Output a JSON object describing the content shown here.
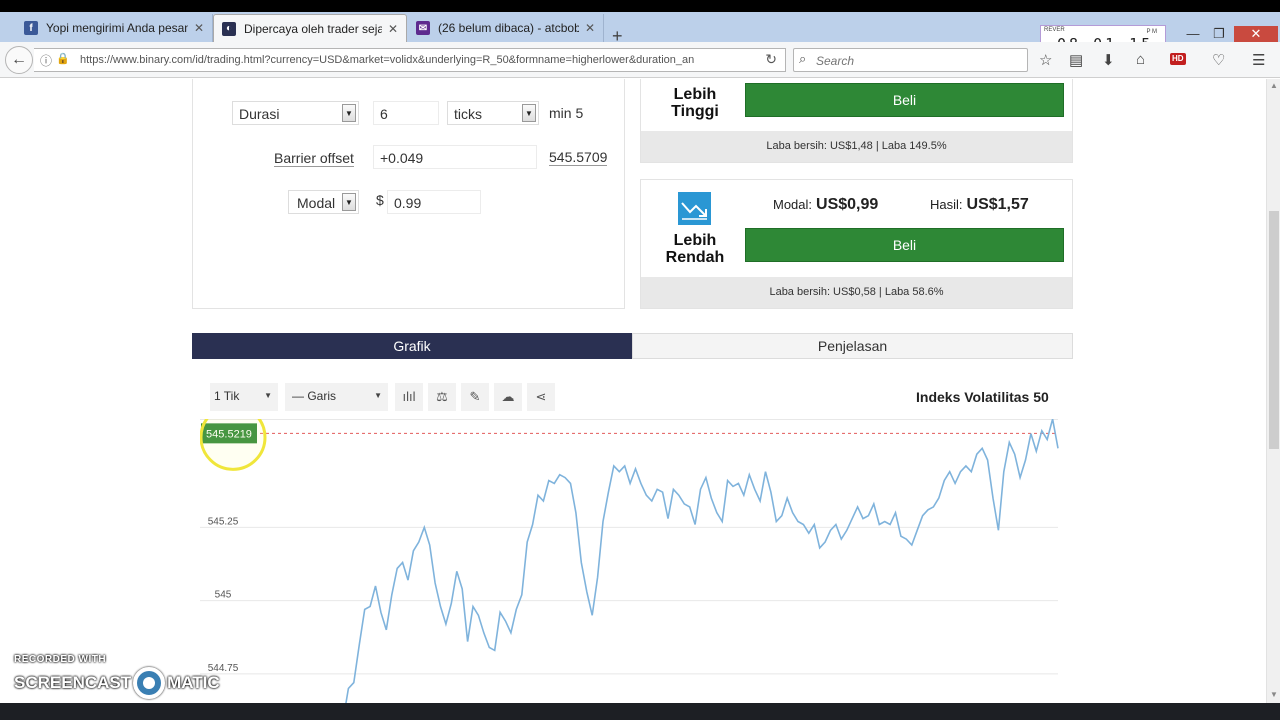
{
  "browser": {
    "tabs": [
      {
        "label": "Yopi mengirimi Anda pesan",
        "close": "✕",
        "favicon": "f"
      },
      {
        "label": "Dipercaya oleh trader sejak...",
        "close": "✕",
        "favicon": "◐"
      },
      {
        "label": "(26 belum dibaca) - atcbob...",
        "close": "✕",
        "favicon": "✉"
      }
    ],
    "new_tab": "+",
    "clock": {
      "brand": "REVER",
      "time": "08 01 15",
      "ampm": "P M"
    },
    "window": {
      "minimize": "—",
      "restore": "❐",
      "close": "✕"
    },
    "url": "https://www.binary.com/id/trading.html?currency=USD&market=volidx&underlying=R_50&formname=higherlower&duration_an",
    "search_placeholder": "Search",
    "hd_badge": "HD",
    "colors": {
      "tab_strip": "#bcd0ea",
      "nav": "#f5f6f7"
    }
  },
  "form": {
    "duration_label": "Durasi",
    "duration_value": "6",
    "duration_unit": "ticks",
    "duration_min": "min 5",
    "barrier_label": "Barrier offset",
    "barrier_value": "+0.049",
    "barrier_price": "545.5709",
    "amount_label": "Modal",
    "currency_symbol": "$",
    "amount_value": "0.99"
  },
  "contracts": {
    "higher": {
      "title_line1": "Lebih",
      "title_line2": "Tinggi",
      "buy_label": "Beli",
      "footer": "Laba bersih: US$1,48 | Laba 149.5%"
    },
    "lower": {
      "title_line1": "Lebih",
      "title_line2": "Rendah",
      "stake_label": "Modal:",
      "stake_value": "US$0,99",
      "payout_label": "Hasil:",
      "payout_value": "US$1,57",
      "buy_label": "Beli",
      "footer": "Laba bersih: US$0,58 | Laba 58.6%",
      "icon_color": "#2a97d4"
    },
    "buy_color": "#2e8836"
  },
  "chart_tabs": {
    "active": "Grafik",
    "inactive": "Penjelasan",
    "active_color": "#2a3052"
  },
  "chart_toolbar": {
    "timeframe": "1 Tik",
    "chart_type": "— Garis",
    "icons": [
      "indicators-icon",
      "compare-icon",
      "draw-icon",
      "download-icon",
      "share-icon"
    ],
    "title": "Indeks Volatilitas 50"
  },
  "chart_data": {
    "type": "line",
    "title": "Indeks Volatilitas 50",
    "y_ticks": [
      "545.25",
      "545",
      "544.75"
    ],
    "ylim": [
      544.63,
      545.62
    ],
    "current_price_label": "545.5219",
    "barrier_level": 545.571,
    "line_color": "#7fb3dc",
    "barrier_color": "#e25b5b",
    "price_tag_color": "#2e8836",
    "series": [
      {
        "values": [
          544.59,
          544.7,
          544.72,
          544.85,
          544.97,
          544.98,
          545.05,
          544.96,
          544.9,
          545.02,
          545.11,
          545.13,
          545.07,
          545.17,
          545.2,
          545.25,
          545.19,
          545.06,
          544.98,
          544.92,
          544.99,
          545.1,
          545.04,
          544.86,
          544.98,
          544.95,
          544.89,
          544.84,
          544.83,
          544.96,
          544.93,
          544.89,
          544.97,
          545.02,
          545.2,
          545.26,
          545.36,
          545.34,
          545.41,
          545.4,
          545.43,
          545.42,
          545.4,
          545.3,
          545.13,
          545.03,
          544.95,
          545.08,
          545.27,
          545.37,
          545.46,
          545.44,
          545.46,
          545.4,
          545.45,
          545.4,
          545.36,
          545.34,
          545.38,
          545.37,
          545.28,
          545.38,
          545.36,
          545.33,
          545.32,
          545.26,
          545.38,
          545.42,
          545.35,
          545.3,
          545.27,
          545.41,
          545.39,
          545.4,
          545.36,
          545.43,
          545.38,
          545.34,
          545.44,
          545.37,
          545.27,
          545.29,
          545.35,
          545.3,
          545.27,
          545.26,
          545.23,
          545.26,
          545.18,
          545.2,
          545.24,
          545.26,
          545.21,
          545.24,
          545.28,
          545.32,
          545.28,
          545.29,
          545.33,
          545.26,
          545.27,
          545.26,
          545.3,
          545.22,
          545.21,
          545.19,
          545.24,
          545.29,
          545.31,
          545.32,
          545.35,
          545.41,
          545.44,
          545.4,
          545.44,
          545.46,
          545.44,
          545.5,
          545.52,
          545.48,
          545.35,
          545.24,
          545.44,
          545.54,
          545.5,
          545.42,
          545.48,
          545.57,
          545.51,
          545.58,
          545.55,
          545.62,
          545.52
        ]
      }
    ],
    "grid": true
  },
  "watermark": {
    "line1": "RECORDED WITH",
    "left": "SCREENCAST",
    "right": "MATIC"
  }
}
